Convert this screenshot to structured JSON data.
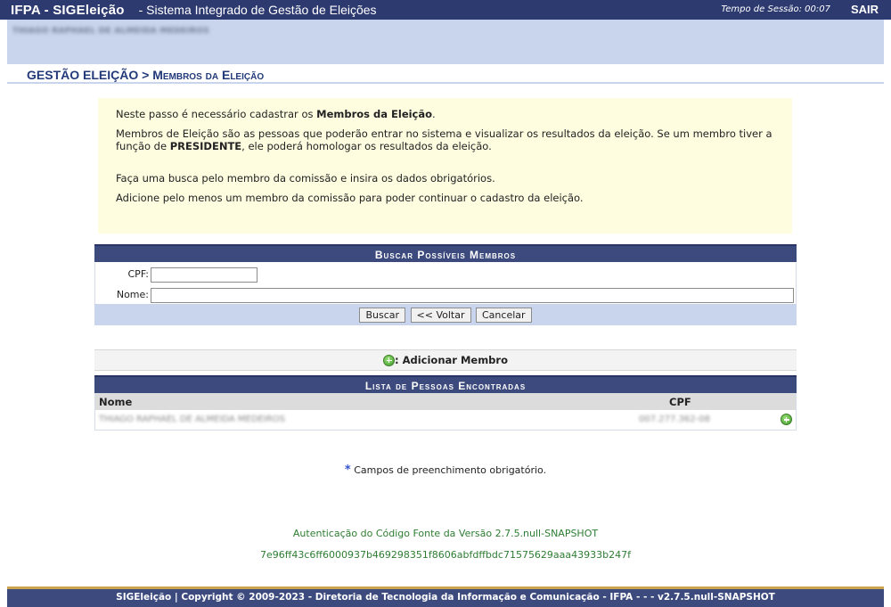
{
  "header": {
    "brand": "IFPA - SIGEleição",
    "subtitle": "- Sistema Integrado de Gestão de Eleições",
    "session_label": "Tempo de Sessão: 00:07",
    "exit_label": "SAIR"
  },
  "user": {
    "name": "THIAGO RAPHAEL DE ALMEIDA MEDEIROS"
  },
  "breadcrumb": {
    "part1": "GESTÃO ELEIÇÃO",
    "sep": " > ",
    "part2": "Membros da Eleição"
  },
  "info": {
    "p1_pre": "Neste passo é necessário cadastrar os ",
    "p1_bold": "Membros da Eleição",
    "p1_post": ".",
    "p2_pre": "Membros de Eleição são as pessoas que poderão entrar no sistema e visualizar os resultados da eleição. Se um membro tiver a função de ",
    "p2_bold": "PRESIDENTE",
    "p2_post": ", ele poderá homologar os resultados da eleição.",
    "p3": "Faça uma busca pelo membro da comissão e insira os dados obrigatórios.",
    "p4": "Adicione pelo menos um membro da comissão para poder continuar o cadastro da eleição."
  },
  "search": {
    "title": "Buscar Possíveis Membros",
    "cpf_label": "CPF:",
    "cpf_value": "",
    "name_label": "Nome:",
    "name_value": "",
    "buttons": {
      "search": "Buscar",
      "back": "<< Voltar",
      "cancel": "Cancelar"
    }
  },
  "add_member": {
    "label": ": Adicionar Membro",
    "icon": "add-circle-icon"
  },
  "results": {
    "title": "Lista de Pessoas Encontradas",
    "columns": [
      "Nome",
      "CPF"
    ],
    "rows": [
      {
        "name": "THIAGO RAPHAEL DE ALMEIDA MEDEIROS",
        "cpf": "007.277.362-08"
      }
    ]
  },
  "required_note": "Campos de preenchimento obrigatório.",
  "auth": {
    "line1": "Autenticação do Código Fonte da Versão 2.7.5.null-SNAPSHOT",
    "line2": "7e96ff43c6ff6000937b469298351f8606abfdffbdc71575629aaa43933b247f"
  },
  "footer": "SIGEleição | Copyright © 2009-2023 - Diretoria de Tecnologia da Informação e Comunicação - IFPA - - - v2.7.5.null-SNAPSHOT",
  "colors": {
    "header_bg": "#2d3a70",
    "band_bg": "#c8d5ed",
    "info_bg": "#fffde0",
    "section_bg": "#3c4a7e",
    "auth_text": "#2e7d32",
    "footer_accent": "#c9a34e"
  }
}
